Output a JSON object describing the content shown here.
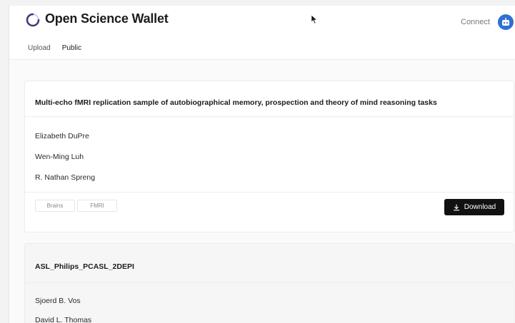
{
  "app": {
    "title": "Open Science Wallet",
    "connect_label": "Connect"
  },
  "tabs": [
    {
      "label": "Upload",
      "active": false
    },
    {
      "label": "Public",
      "active": true
    }
  ],
  "datasets": [
    {
      "title": "Multi-echo fMRI replication sample of autobiographical memory, prospection and theory of mind reasoning tasks",
      "authors": [
        "Elizabeth DuPre",
        "Wen-Ming Luh",
        "R. Nathan Spreng"
      ],
      "tags": [
        "Brains",
        "FMRI"
      ],
      "download_label": "Download"
    },
    {
      "title": "ASL_Philips_PCASL_2DEPI",
      "authors": [
        "Sjoerd B. Vos",
        "David L. Thomas"
      ]
    }
  ],
  "icons": {
    "logo": "spinner-logo-icon",
    "wallet": "robot-icon",
    "download": "download-icon",
    "cursor": "mouse-cursor-icon"
  },
  "colors": {
    "accent": "#2f6fd6",
    "download_bg": "#111111"
  }
}
